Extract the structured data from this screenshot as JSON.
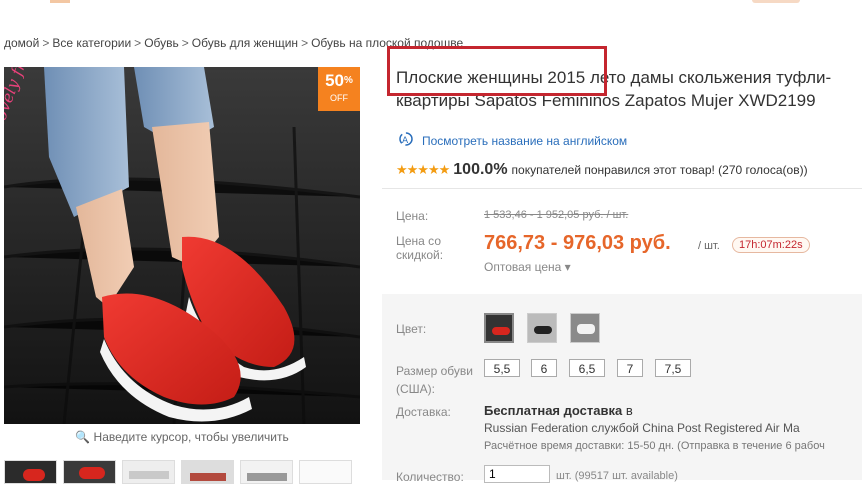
{
  "breadcrumb": [
    "домой",
    "Все категории",
    "Обувь",
    "Обувь для женщин",
    "Обувь на плоской подошве"
  ],
  "discount_badge": {
    "value": "50",
    "unit": "%",
    "label": "OFF"
  },
  "zoom_hint": "Наведите курсор, чтобы увеличить",
  "title": {
    "line1": "Плоские женщины 2015 лето дамы скольжения туфли-",
    "line2": "квартиры Sapatos Femininos Zapatos Mujer XWD2199"
  },
  "translate_link": "Посмотреть название на английском",
  "rating": {
    "stars": "★★★★★",
    "percent": "100.0%",
    "text": "покупателей понравился этот товар! (270 голоса(ов))"
  },
  "price": {
    "label_price": "Цена:",
    "old": "1 533,46 - 1 952,05 руб. / шт.",
    "label_discount": "Цена со скидкой:",
    "current": "766,73 - 976,03 руб.",
    "unit": "/ шт.",
    "timer": "17h:07m:22s",
    "wholesale": "Оптовая цена ▾"
  },
  "options": {
    "color_label": "Цвет:",
    "size_label": "Размер обуви (США):",
    "sizes": [
      "5,5",
      "6",
      "6,5",
      "7",
      "7,5"
    ],
    "shipping_label": "Доставка:",
    "shipping_free": "Бесплатная доставка",
    "shipping_in": "в",
    "shipping_line2": "Russian Federation службой China Post Registered Air Ma",
    "shipping_line3": "Расчётное время доставки: 15-50 дн. (Отправка в течение 6 рабоч",
    "qty_label": "Количество:",
    "qty_value": "1",
    "qty_info": "шт. (99517 шт. available)"
  },
  "colors": {
    "accent_orange": "#e6662a",
    "badge_orange": "#f5821f",
    "highlight_red": "#c4262f",
    "link_blue": "#2a6ebb"
  }
}
